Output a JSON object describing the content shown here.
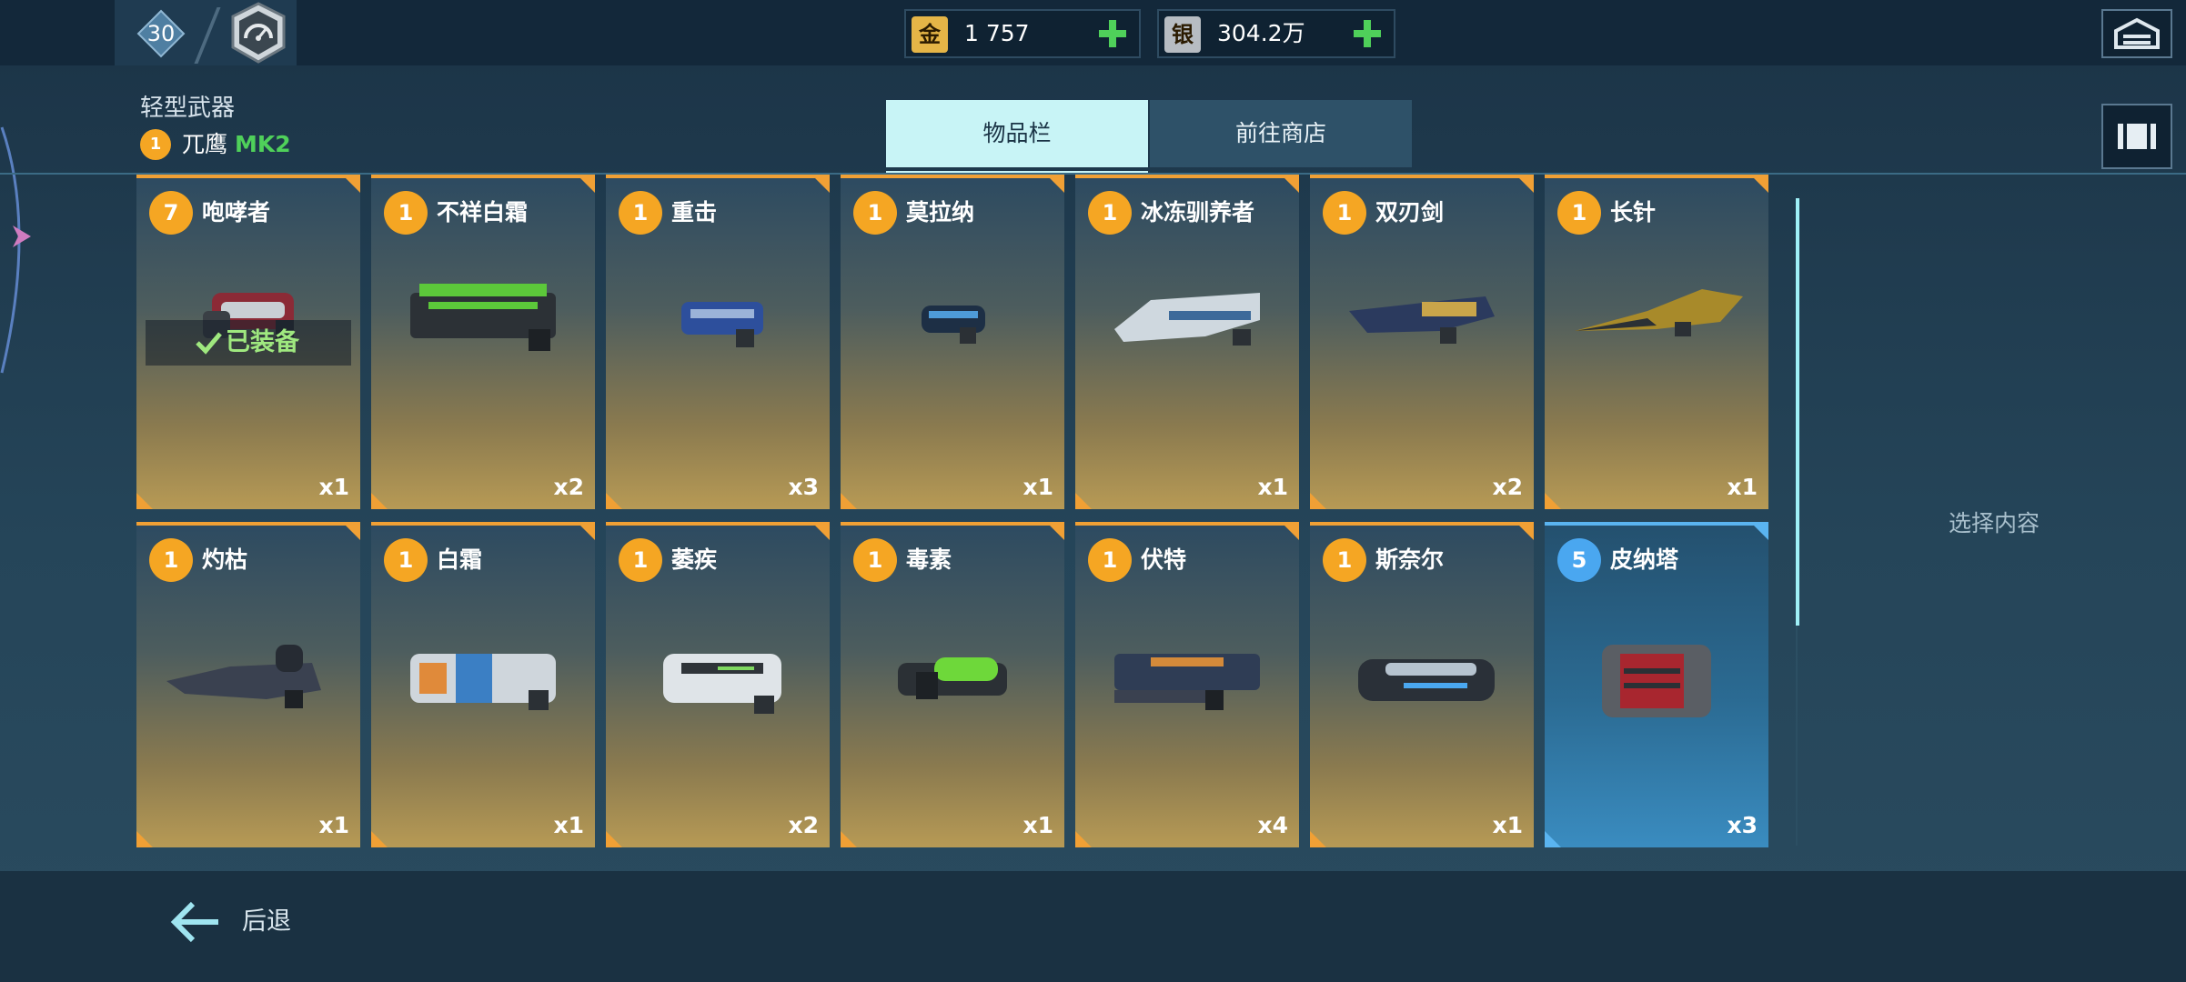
{
  "header": {
    "level": "30",
    "gold": {
      "icon_char": "金",
      "value": "1 757"
    },
    "silver": {
      "icon_char": "银",
      "value": "304.2万"
    }
  },
  "loadout": {
    "weapon_type": "轻型武器",
    "robot_level": "1",
    "robot_name": "兀鹰",
    "robot_mk": "MK2"
  },
  "tabs": [
    {
      "label": "物品栏",
      "active": true
    },
    {
      "label": "前往商店",
      "active": false
    }
  ],
  "equipped_label": "已装备",
  "details_placeholder": "选择内容",
  "back_label": "后退",
  "colors": {
    "rarity_orange": "#f5a623",
    "rarity_blue": "#4aa7f0",
    "accent_green": "#4fd05a"
  },
  "weapons": [
    {
      "level": "7",
      "name": "咆哮者",
      "qty": "x1",
      "equipped": true,
      "rarity": "orange"
    },
    {
      "level": "1",
      "name": "不祥白霜",
      "qty": "x2",
      "rarity": "orange"
    },
    {
      "level": "1",
      "name": "重击",
      "qty": "x3",
      "rarity": "orange"
    },
    {
      "level": "1",
      "name": "莫拉纳",
      "qty": "x1",
      "rarity": "orange"
    },
    {
      "level": "1",
      "name": "冰冻驯养者",
      "qty": "x1",
      "rarity": "orange"
    },
    {
      "level": "1",
      "name": "双刃剑",
      "qty": "x2",
      "rarity": "orange"
    },
    {
      "level": "1",
      "name": "长针",
      "qty": "x1",
      "rarity": "orange"
    },
    {
      "level": "1",
      "name": "灼枯",
      "qty": "x1",
      "rarity": "orange"
    },
    {
      "level": "1",
      "name": "白霜",
      "qty": "x1",
      "rarity": "orange"
    },
    {
      "level": "1",
      "name": "萎疾",
      "qty": "x2",
      "rarity": "orange"
    },
    {
      "level": "1",
      "name": "毒素",
      "qty": "x1",
      "rarity": "orange"
    },
    {
      "level": "1",
      "name": "伏特",
      "qty": "x4",
      "rarity": "orange"
    },
    {
      "level": "1",
      "name": "斯奈尔",
      "qty": "x1",
      "rarity": "orange"
    },
    {
      "level": "5",
      "name": "皮纳塔",
      "qty": "x3",
      "rarity": "blue"
    }
  ]
}
